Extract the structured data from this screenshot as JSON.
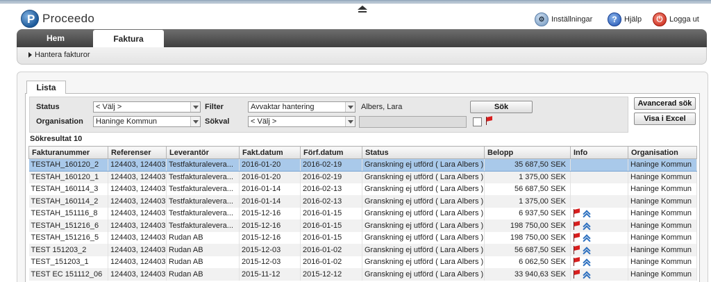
{
  "header": {
    "brand": "Proceedo",
    "links": [
      {
        "label": "Inställningar",
        "icon": "settings-user-icon"
      },
      {
        "label": "Hjälp",
        "icon": "help-icon"
      },
      {
        "label": "Logga ut",
        "icon": "power-icon"
      }
    ]
  },
  "nav": {
    "tabs": [
      {
        "label": "Hem",
        "active": false
      },
      {
        "label": "Faktura",
        "active": true
      }
    ],
    "sub_item": "Hantera fakturor"
  },
  "list_tab": "Lista",
  "filters": {
    "status_label": "Status",
    "status_value": "< Välj >",
    "org_label": "Organisation",
    "org_value": "Haninge Kommun",
    "filter_label": "Filter",
    "filter_value": "Avvaktar hantering",
    "filter_user": "Albers, Lara",
    "sokval_label": "Sökval",
    "sokval_value": "< Välj >",
    "sokval_text": "",
    "search_button": "Sök",
    "advanced_button": "Avancerad sök",
    "excel_button": "Visa i Excel"
  },
  "results": {
    "count_label": "Sökresultat 10",
    "columns": [
      "Fakturanummer",
      "Referenser",
      "Leverantör",
      "Fakt.datum",
      "Förf.datum",
      "Status",
      "Belopp",
      "Info",
      "Organisation"
    ],
    "rows": [
      {
        "nr": "TESTAH_160120_2",
        "ref": "124403, 124403",
        "lev": "Testfakturaleverа...",
        "fakt": "2016-01-20",
        "forf": "2016-02-19",
        "status": "Granskning ej utförd ( Lara Albers )",
        "belopp": "35 687,50 SEK",
        "flag": false,
        "chev": false,
        "org": "Haninge Kommun"
      },
      {
        "nr": "TESTAH_160120_1",
        "ref": "124403, 124403",
        "lev": "Testfakturaleverа...",
        "fakt": "2016-01-20",
        "forf": "2016-02-19",
        "status": "Granskning ej utförd ( Lara Albers )",
        "belopp": "1 375,00 SEK",
        "flag": false,
        "chev": false,
        "org": "Haninge Kommun"
      },
      {
        "nr": "TESTAH_160114_3",
        "ref": "124403, 124403",
        "lev": "Testfakturaleverа...",
        "fakt": "2016-01-14",
        "forf": "2016-02-13",
        "status": "Granskning ej utförd ( Lara Albers )",
        "belopp": "56 687,50 SEK",
        "flag": false,
        "chev": false,
        "org": "Haninge Kommun"
      },
      {
        "nr": "TESTAH_160114_2",
        "ref": "124403, 124403",
        "lev": "Testfakturaleverа...",
        "fakt": "2016-01-14",
        "forf": "2016-02-13",
        "status": "Granskning ej utförd ( Lara Albers )",
        "belopp": "1 375,00 SEK",
        "flag": false,
        "chev": false,
        "org": "Haninge Kommun"
      },
      {
        "nr": "TESTAH_151116_8",
        "ref": "124403, 124403",
        "lev": "Testfakturaleverа...",
        "fakt": "2015-12-16",
        "forf": "2016-01-15",
        "status": "Granskning ej utförd ( Lara Albers )",
        "belopp": "6 937,50 SEK",
        "flag": true,
        "chev": true,
        "org": "Haninge Kommun"
      },
      {
        "nr": "TESTAH_151216_6",
        "ref": "124403, 124403",
        "lev": "Testfakturaleverа...",
        "fakt": "2015-12-16",
        "forf": "2016-01-15",
        "status": "Granskning ej utförd ( Lara Albers )",
        "belopp": "198 750,00 SEK",
        "flag": true,
        "chev": true,
        "org": "Haninge Kommun"
      },
      {
        "nr": "TESTAH_151216_5",
        "ref": "124403, 124403",
        "lev": "Rudan AB",
        "fakt": "2015-12-16",
        "forf": "2016-01-15",
        "status": "Granskning ej utförd ( Lara Albers )",
        "belopp": "198 750,00 SEK",
        "flag": true,
        "chev": true,
        "org": "Haninge Kommun"
      },
      {
        "nr": "TEST 151203_2",
        "ref": "124403, 124403",
        "lev": "Rudan AB",
        "fakt": "2015-12-03",
        "forf": "2016-01-02",
        "status": "Granskning ej utförd ( Lara Albers )",
        "belopp": "56 687,50 SEK",
        "flag": true,
        "chev": true,
        "org": "Haninge Kommun"
      },
      {
        "nr": "TEST_151203_1",
        "ref": "124403, 124403",
        "lev": "Rudan AB",
        "fakt": "2015-12-03",
        "forf": "2016-01-02",
        "status": "Granskning ej utförd ( Lara Albers )",
        "belopp": "6 062,50 SEK",
        "flag": true,
        "chev": true,
        "org": "Haninge Kommun"
      },
      {
        "nr": "TEST EC 151112_06",
        "ref": "124403, 124403",
        "lev": "Rudan AB",
        "fakt": "2015-11-12",
        "forf": "2015-12-12",
        "status": "Granskning ej utförd ( Lara Albers )",
        "belopp": "33 940,63 SEK",
        "flag": true,
        "chev": true,
        "org": "Haninge Kommun"
      }
    ]
  },
  "colors": {
    "nav_bg": "#4f4f4f",
    "selected_row": "#a9c9ea",
    "flag": "#d81e1e",
    "chevron": "#2b6fbf"
  }
}
